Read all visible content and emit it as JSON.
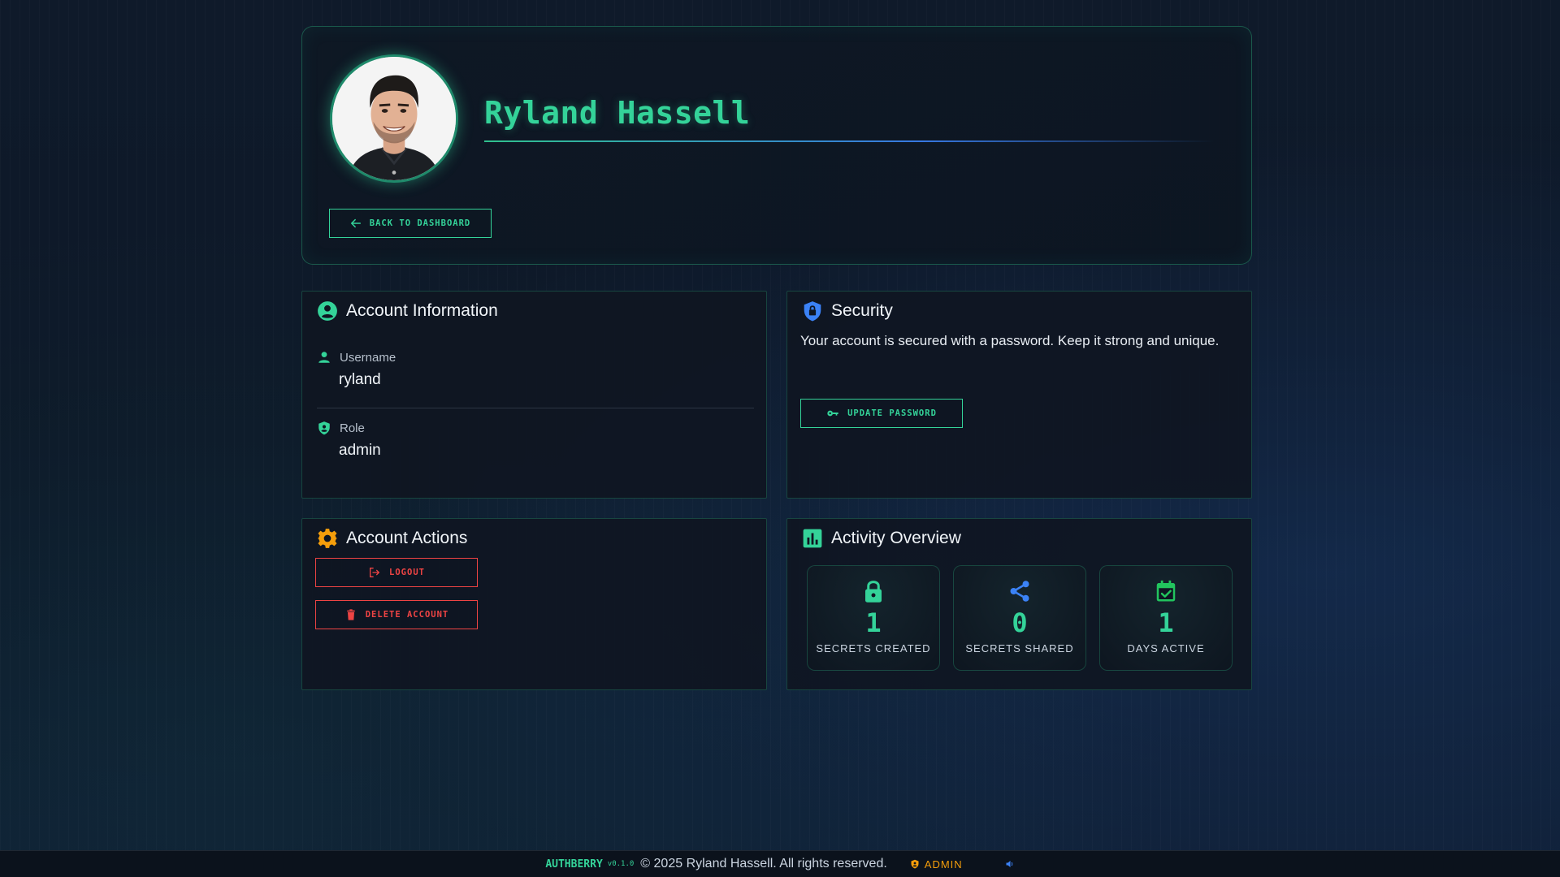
{
  "profile": {
    "name": "Ryland Hassell",
    "back_label": "BACK TO DASHBOARD"
  },
  "account_info": {
    "title": "Account Information",
    "fields": [
      {
        "label": "Username",
        "value": "ryland",
        "icon": "user-icon"
      },
      {
        "label": "Role",
        "value": "admin",
        "icon": "shield-user-icon"
      }
    ]
  },
  "security": {
    "title": "Security",
    "description": "Your account is secured with a password. Keep it strong and unique.",
    "update_label": "UPDATE PASSWORD"
  },
  "actions": {
    "title": "Account Actions",
    "logout_label": "LOGOUT",
    "delete_label": "DELETE ACCOUNT"
  },
  "activity": {
    "title": "Activity Overview",
    "stats": [
      {
        "value": "1",
        "label": "SECRETS CREATED",
        "icon": "lock-icon",
        "color": "#34d399"
      },
      {
        "value": "0",
        "label": "SECRETS SHARED",
        "icon": "share-icon",
        "color": "#3b82f6"
      },
      {
        "value": "1",
        "label": "DAYS ACTIVE",
        "icon": "calendar-check-icon",
        "color": "#22c55e"
      }
    ]
  },
  "footer": {
    "brand": "AUTHBERRY",
    "version": "v0.1.0",
    "copyright": "© 2025 Ryland Hassell. All rights reserved.",
    "role": "ADMIN"
  },
  "colors": {
    "accent": "#34d399",
    "danger": "#ef4444",
    "info": "#3b82f6",
    "warning": "#f59e0b"
  }
}
